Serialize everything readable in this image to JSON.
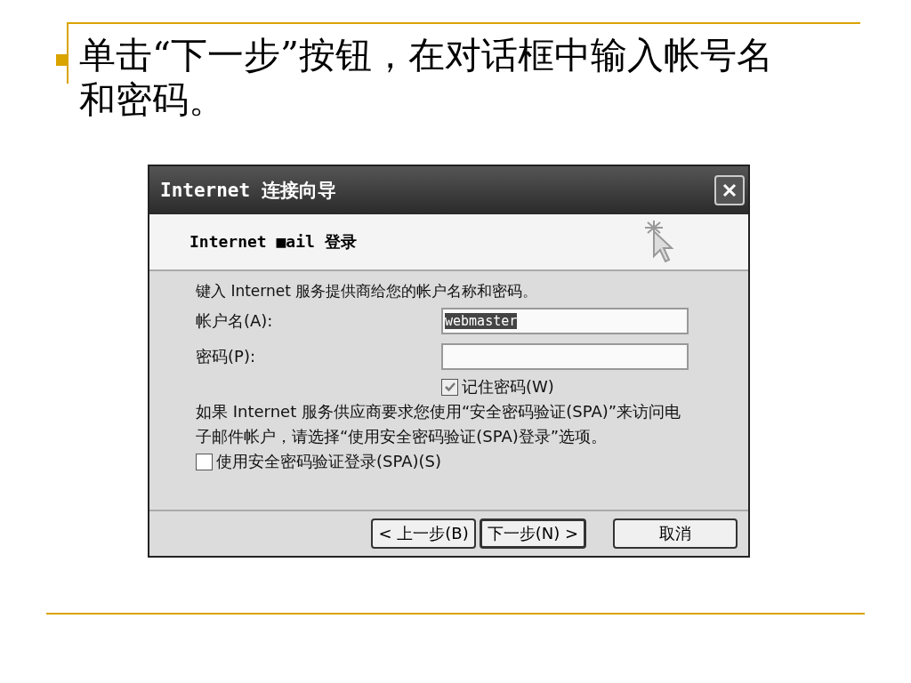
{
  "slide": {
    "bullet_text": "单击“下一步”按钮，在对话框中输入帐号名和密码。"
  },
  "dialog": {
    "title": "Internet 连接向导",
    "header": "Internet ■ail 登录",
    "intro": "键入 Internet 服务提供商给您的帐户名称和密码。",
    "fields": [
      {
        "label": "帐户名(A):",
        "value": "webmaster",
        "selected_text": true
      },
      {
        "label": "密码(P):"
      }
    ],
    "remember": {
      "label": "记住密码(W)",
      "checked": true
    },
    "note": "如果 Internet 服务供应商要求您使用“安全密码验证(SPA)”来访问电子邮件帐户，请选择“使用安全密码验证(SPA)登录”选项。",
    "spa": {
      "label": "使用安全密码验证登录(SPA)(S)",
      "checked": false
    },
    "buttons": [
      {
        "label": "< 上一步(B)",
        "kind": "nav"
      },
      {
        "label": "下一步(N) >",
        "kind": "default"
      },
      {
        "label": "取消",
        "kind": "cancel"
      }
    ]
  }
}
